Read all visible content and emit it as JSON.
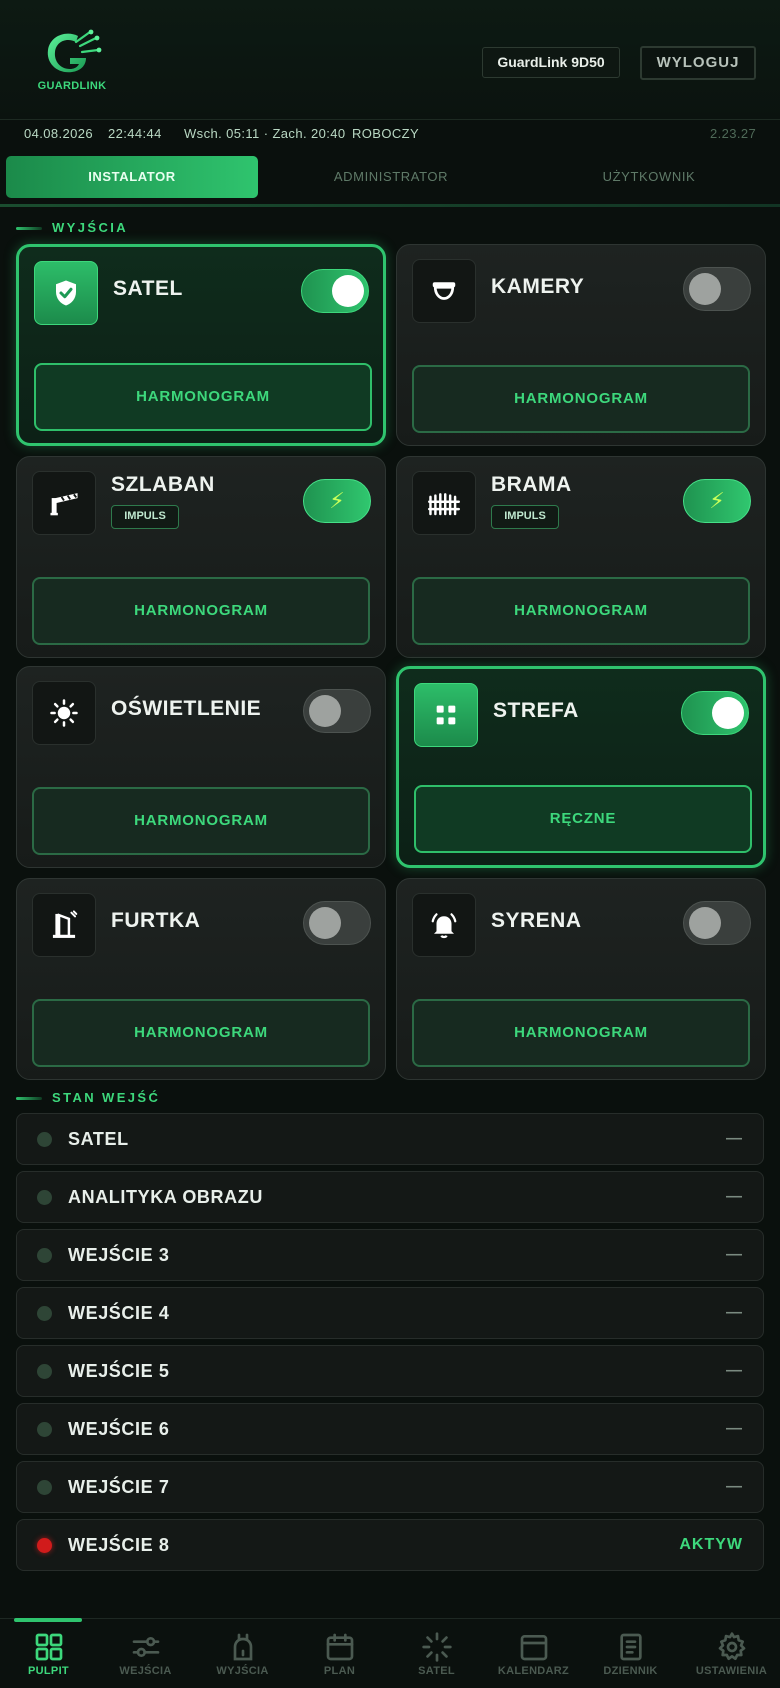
{
  "header": {
    "logo_text": "GUARDLINK",
    "device_label": "GuardLink 9D50",
    "logout_label": "WYLOGUJ"
  },
  "status": {
    "date": "04.08.2026",
    "time": "22:44:44",
    "sun": "Wsch. 05:11 · Zach. 20:40",
    "day_type": "ROBOCZY",
    "version": "2.23.27"
  },
  "roles": [
    {
      "label": "INSTALATOR",
      "active": true
    },
    {
      "label": "ADMINISTRATOR",
      "active": false
    },
    {
      "label": "UŻYTKOWNIK",
      "active": false
    }
  ],
  "outputs_section": {
    "title": "WYJŚCIA"
  },
  "outputs": [
    {
      "name": "SATEL",
      "icon": "shield-check-icon",
      "mode": "toggle",
      "on": true,
      "schedule_label": "HARMONOGRAM"
    },
    {
      "name": "KAMERY",
      "icon": "camera-dome-icon",
      "mode": "toggle",
      "on": false,
      "schedule_label": "HARMONOGRAM"
    },
    {
      "name": "SZLABAN",
      "icon": "barrier-icon",
      "mode": "impulse",
      "badge": "IMPULS",
      "impulse_symbol": "⚡",
      "schedule_label": "HARMONOGRAM"
    },
    {
      "name": "BRAMA",
      "icon": "gate-icon",
      "mode": "impulse",
      "badge": "IMPULS",
      "impulse_symbol": "⚡",
      "schedule_label": "HARMONOGRAM"
    },
    {
      "name": "OŚWIETLENIE",
      "icon": "sun-icon",
      "mode": "toggle",
      "on": false,
      "schedule_label": "HARMONOGRAM"
    },
    {
      "name": "STREFA",
      "icon": "grid-icon",
      "mode": "toggle",
      "on": true,
      "schedule_label": "RĘCZNE"
    },
    {
      "name": "FURTKA",
      "icon": "wicket-gate-icon",
      "mode": "toggle",
      "on": false,
      "schedule_label": "HARMONOGRAM"
    },
    {
      "name": "SYRENA",
      "icon": "bell-icon",
      "mode": "toggle",
      "on": false,
      "schedule_label": "HARMONOGRAM"
    }
  ],
  "inputs_section": {
    "title": "STAN WEJŚĆ"
  },
  "inputs": [
    {
      "name": "SATEL",
      "state": "—",
      "active": false
    },
    {
      "name": "ANALITYKA OBRAZU",
      "state": "—",
      "active": false
    },
    {
      "name": "WEJŚCIE 3",
      "state": "—",
      "active": false
    },
    {
      "name": "WEJŚCIE 4",
      "state": "—",
      "active": false
    },
    {
      "name": "WEJŚCIE 5",
      "state": "—",
      "active": false
    },
    {
      "name": "WEJŚCIE 6",
      "state": "—",
      "active": false
    },
    {
      "name": "WEJŚCIE 7",
      "state": "—",
      "active": false
    },
    {
      "name": "WEJŚCIE 8",
      "state": "AKTYW",
      "active": true
    }
  ],
  "nav": [
    {
      "label": "PULPIT",
      "icon": "dashboard-icon",
      "active": true
    },
    {
      "label": "WEJŚCIA",
      "icon": "sliders-icon",
      "active": false
    },
    {
      "label": "WYJŚCIA",
      "icon": "plug-icon",
      "active": false
    },
    {
      "label": "PLAN",
      "icon": "calendar-icon",
      "active": false
    },
    {
      "label": "SATEL",
      "icon": "loader-icon",
      "active": false
    },
    {
      "label": "KALENDARZ",
      "icon": "window-icon",
      "active": false
    },
    {
      "label": "DZIENNIK",
      "icon": "journal-icon",
      "active": false
    },
    {
      "label": "USTAWIENIA",
      "icon": "gear-icon",
      "active": false
    }
  ],
  "colors": {
    "accent": "#2fc46e",
    "background": "#0a100d",
    "alarm": "#d11b1b"
  }
}
